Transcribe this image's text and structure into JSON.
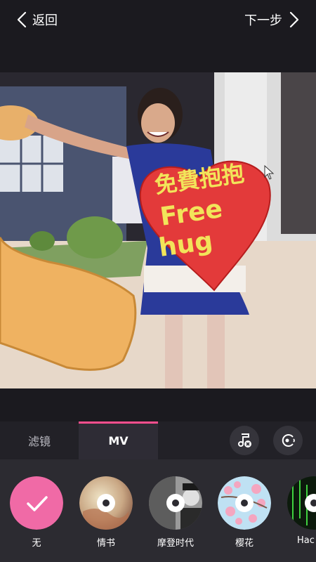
{
  "header": {
    "back_label": "返回",
    "next_label": "下一步"
  },
  "photo": {
    "sign_line1": "免費抱抱",
    "sign_line2": "Free",
    "sign_line3": "hug"
  },
  "tabs": [
    {
      "label": "滤镜",
      "selected": false
    },
    {
      "label": "MV",
      "selected": true
    }
  ],
  "toolbar": {
    "music_icon": "music-remove-icon",
    "sound_icon": "sound-toggle-icon"
  },
  "mv_templates": [
    {
      "label": "无",
      "selected": true
    },
    {
      "label": "情书",
      "selected": false
    },
    {
      "label": "摩登时代",
      "selected": false
    },
    {
      "label": "樱花",
      "selected": false
    },
    {
      "label": "Hac",
      "selected": false
    }
  ],
  "colors": {
    "accent": "#ff4f8e",
    "selected_disc": "#f06aa6",
    "background": "#1b1a1f"
  }
}
